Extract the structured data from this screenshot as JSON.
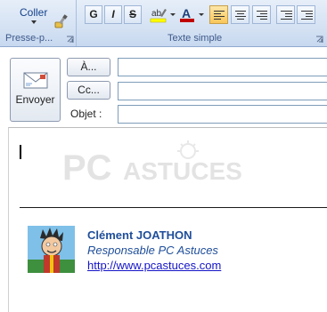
{
  "ribbon": {
    "clipboard": {
      "paste_label": "Coller",
      "group_label": "Presse-p..."
    },
    "basic_text": {
      "group_label": "Texte simple",
      "bold_label": "G",
      "italic_label": "I",
      "strike_label": "S",
      "highlight_color": "#ffff00",
      "font_color": "#c00000",
      "font_color_glyph": "A",
      "active_alignment": "left"
    }
  },
  "compose": {
    "send_label": "Envoyer",
    "to_button": "À...",
    "cc_button": "Cc...",
    "subject_label": "Objet :",
    "to_value": "",
    "cc_value": "",
    "subject_value": ""
  },
  "signature": {
    "name": "Clément JOATHON",
    "role": "Responsable PC Astuces",
    "url": "http://www.pcastuces.com"
  },
  "watermark": {
    "text_pc": "PC",
    "text_astuces": "ASTUCES"
  }
}
